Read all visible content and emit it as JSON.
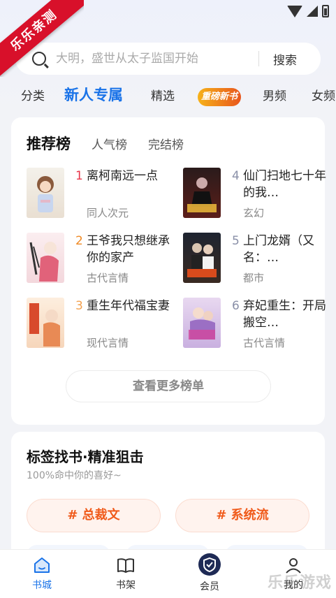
{
  "ribbon": {
    "text": "乐乐亲测"
  },
  "search": {
    "placeholder": "大明，盛世从太子监国开始",
    "button_label": "搜索"
  },
  "tabs": [
    {
      "label": "分类"
    },
    {
      "label": "新人专属",
      "active": true
    },
    {
      "label": "精选"
    },
    {
      "label": "重磅新书"
    },
    {
      "label": "男频"
    },
    {
      "label": "女频"
    }
  ],
  "ranking": {
    "tabs": [
      {
        "label": "推荐榜",
        "active": true
      },
      {
        "label": "人气榜"
      },
      {
        "label": "完结榜"
      }
    ],
    "books": [
      {
        "rank": "1",
        "title": "离柯南远一点",
        "genre": "同人次元"
      },
      {
        "rank": "2",
        "title": "王爷我只想继承你的家产",
        "genre": "古代言情"
      },
      {
        "rank": "3",
        "title": "重生年代福宝妻",
        "genre": "现代言情"
      },
      {
        "rank": "4",
        "title": "仙门扫地七十年的我…",
        "genre": "玄幻"
      },
      {
        "rank": "5",
        "title": "上门龙婿（又名：…",
        "genre": "都市"
      },
      {
        "rank": "6",
        "title": "弃妃重生：开局搬空…",
        "genre": "古代言情"
      }
    ],
    "more_label": "查看更多榜单"
  },
  "tag_section": {
    "title": "标签找书·精准狙击",
    "subtitle": "100%命中你的喜好~",
    "chips": [
      {
        "label": "# 总裁文"
      },
      {
        "label": "# 系统流"
      }
    ]
  },
  "bottom_nav": [
    {
      "label": "书城",
      "active": true
    },
    {
      "label": "书架"
    },
    {
      "label": "会员"
    },
    {
      "label": "我的"
    }
  ],
  "watermark": "乐乐游戏",
  "colors": {
    "accent": "#1a73e8",
    "rank_top": "#e8364a",
    "rank_mid": "#f08a24",
    "rank_low": "#a5abc0",
    "tag": "#f05a1a"
  }
}
